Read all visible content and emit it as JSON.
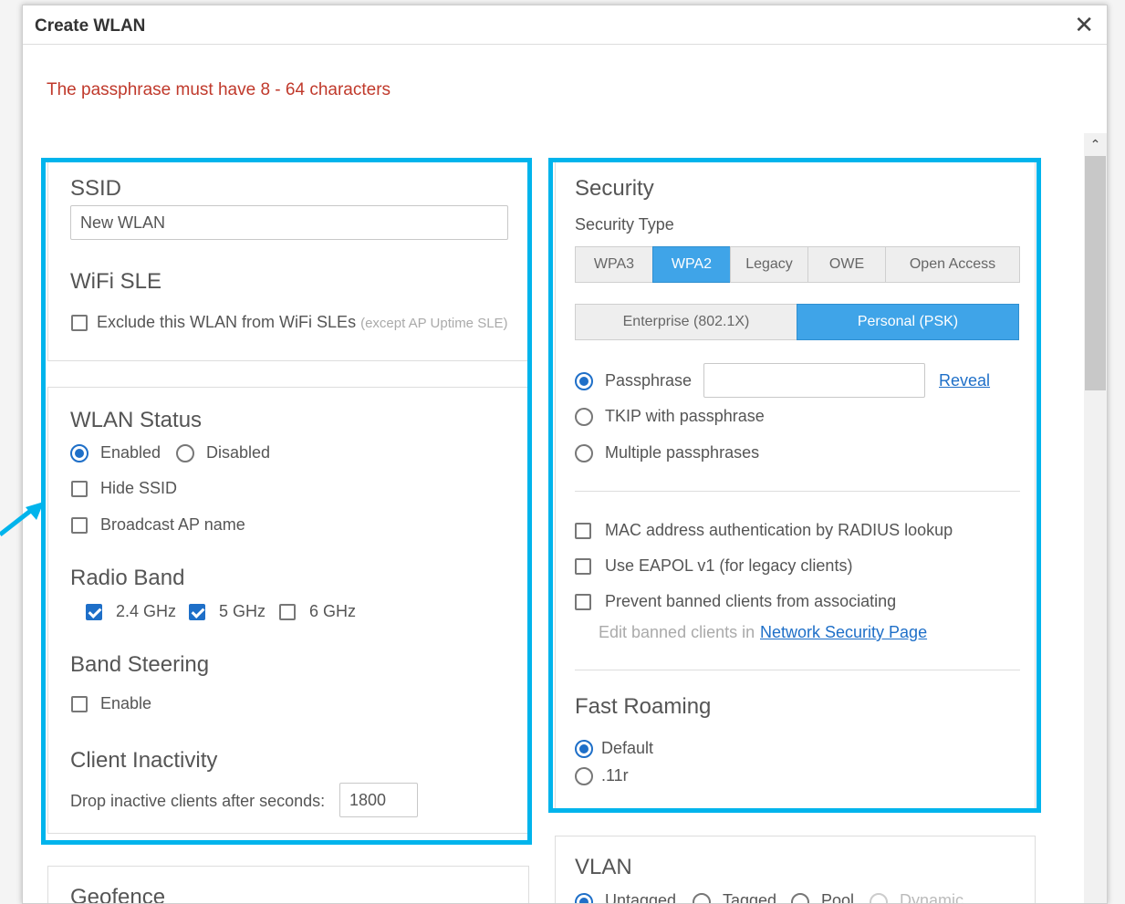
{
  "dialog": {
    "title": "Create WLAN",
    "close_symbol": "✕",
    "error_message": "The passphrase must have 8 - 64 characters"
  },
  "scrollbar": {
    "up_symbol": "⌃"
  },
  "ssid": {
    "title": "SSID",
    "value": "New WLAN"
  },
  "wifi_sle": {
    "title": "WiFi SLE",
    "exclude_label": "Exclude this WLAN from WiFi SLEs",
    "exclude_note": "(except AP Uptime SLE)",
    "exclude_checked": false
  },
  "wlan_status": {
    "title": "WLAN Status",
    "enabled_label": "Enabled",
    "disabled_label": "Disabled",
    "selected": "Enabled",
    "hide_ssid_label": "Hide SSID",
    "broadcast_ap_label": "Broadcast AP name"
  },
  "radio_band": {
    "title": "Radio Band",
    "options": [
      {
        "label": "2.4 GHz",
        "checked": true
      },
      {
        "label": "5 GHz",
        "checked": true
      },
      {
        "label": "6 GHz",
        "checked": false
      }
    ]
  },
  "band_steering": {
    "title": "Band Steering",
    "enable_label": "Enable",
    "checked": false
  },
  "client_inactivity": {
    "title": "Client Inactivity",
    "label": "Drop inactive clients after seconds:",
    "value": "1800"
  },
  "geofence": {
    "title": "Geofence"
  },
  "security": {
    "title": "Security",
    "type_label": "Security Type",
    "types": [
      "WPA3",
      "WPA2",
      "Legacy",
      "OWE",
      "Open Access"
    ],
    "selected_type": "WPA2",
    "modes": [
      "Enterprise (802.1X)",
      "Personal (PSK)"
    ],
    "selected_mode": "Personal (PSK)",
    "passphrase_label": "Passphrase",
    "passphrase_value": "",
    "reveal_label": "Reveal",
    "tkip_label": "TKIP with passphrase",
    "multiple_label": "Multiple passphrases",
    "selected_key_option": "Passphrase",
    "mac_auth_label": "MAC address authentication by RADIUS lookup",
    "eapol_label": "Use EAPOL v1 (for legacy clients)",
    "banned_label": "Prevent banned clients from associating",
    "edit_banned_prefix": "Edit banned clients in",
    "network_security_link": "Network Security Page"
  },
  "fast_roaming": {
    "title": "Fast Roaming",
    "options": [
      "Default",
      ".11r"
    ],
    "selected": "Default"
  },
  "vlan": {
    "title": "VLAN",
    "options": [
      "Untagged",
      "Tagged",
      "Pool",
      "Dynamic"
    ],
    "selected": "Untagged"
  },
  "colors": {
    "highlight": "#00b4ec",
    "accent": "#1e6fc8",
    "error": "#c0392b",
    "segment_active": "#3fa4e8"
  }
}
